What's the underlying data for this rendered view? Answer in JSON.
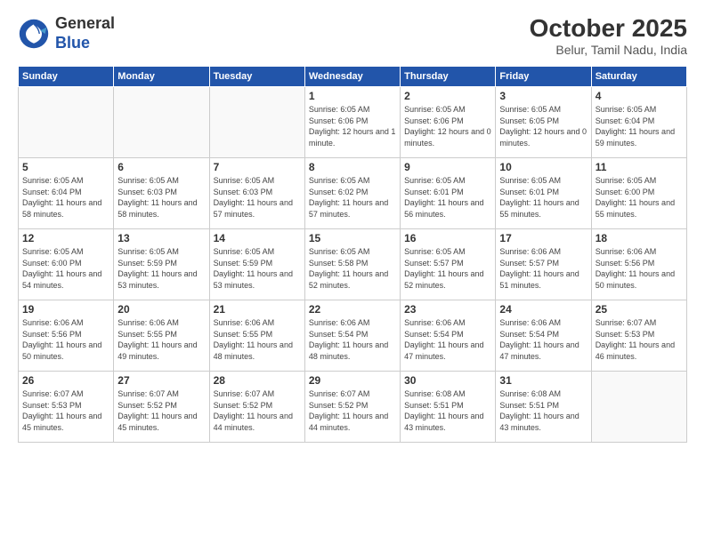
{
  "header": {
    "logo_general": "General",
    "logo_blue": "Blue",
    "month_year": "October 2025",
    "location": "Belur, Tamil Nadu, India"
  },
  "weekdays": [
    "Sunday",
    "Monday",
    "Tuesday",
    "Wednesday",
    "Thursday",
    "Friday",
    "Saturday"
  ],
  "weeks": [
    [
      {
        "day": "",
        "sunrise": "",
        "sunset": "",
        "daylight": ""
      },
      {
        "day": "",
        "sunrise": "",
        "sunset": "",
        "daylight": ""
      },
      {
        "day": "",
        "sunrise": "",
        "sunset": "",
        "daylight": ""
      },
      {
        "day": "1",
        "sunrise": "Sunrise: 6:05 AM",
        "sunset": "Sunset: 6:06 PM",
        "daylight": "Daylight: 12 hours and 1 minute."
      },
      {
        "day": "2",
        "sunrise": "Sunrise: 6:05 AM",
        "sunset": "Sunset: 6:06 PM",
        "daylight": "Daylight: 12 hours and 0 minutes."
      },
      {
        "day": "3",
        "sunrise": "Sunrise: 6:05 AM",
        "sunset": "Sunset: 6:05 PM",
        "daylight": "Daylight: 12 hours and 0 minutes."
      },
      {
        "day": "4",
        "sunrise": "Sunrise: 6:05 AM",
        "sunset": "Sunset: 6:04 PM",
        "daylight": "Daylight: 11 hours and 59 minutes."
      }
    ],
    [
      {
        "day": "5",
        "sunrise": "Sunrise: 6:05 AM",
        "sunset": "Sunset: 6:04 PM",
        "daylight": "Daylight: 11 hours and 58 minutes."
      },
      {
        "day": "6",
        "sunrise": "Sunrise: 6:05 AM",
        "sunset": "Sunset: 6:03 PM",
        "daylight": "Daylight: 11 hours and 58 minutes."
      },
      {
        "day": "7",
        "sunrise": "Sunrise: 6:05 AM",
        "sunset": "Sunset: 6:03 PM",
        "daylight": "Daylight: 11 hours and 57 minutes."
      },
      {
        "day": "8",
        "sunrise": "Sunrise: 6:05 AM",
        "sunset": "Sunset: 6:02 PM",
        "daylight": "Daylight: 11 hours and 57 minutes."
      },
      {
        "day": "9",
        "sunrise": "Sunrise: 6:05 AM",
        "sunset": "Sunset: 6:01 PM",
        "daylight": "Daylight: 11 hours and 56 minutes."
      },
      {
        "day": "10",
        "sunrise": "Sunrise: 6:05 AM",
        "sunset": "Sunset: 6:01 PM",
        "daylight": "Daylight: 11 hours and 55 minutes."
      },
      {
        "day": "11",
        "sunrise": "Sunrise: 6:05 AM",
        "sunset": "Sunset: 6:00 PM",
        "daylight": "Daylight: 11 hours and 55 minutes."
      }
    ],
    [
      {
        "day": "12",
        "sunrise": "Sunrise: 6:05 AM",
        "sunset": "Sunset: 6:00 PM",
        "daylight": "Daylight: 11 hours and 54 minutes."
      },
      {
        "day": "13",
        "sunrise": "Sunrise: 6:05 AM",
        "sunset": "Sunset: 5:59 PM",
        "daylight": "Daylight: 11 hours and 53 minutes."
      },
      {
        "day": "14",
        "sunrise": "Sunrise: 6:05 AM",
        "sunset": "Sunset: 5:59 PM",
        "daylight": "Daylight: 11 hours and 53 minutes."
      },
      {
        "day": "15",
        "sunrise": "Sunrise: 6:05 AM",
        "sunset": "Sunset: 5:58 PM",
        "daylight": "Daylight: 11 hours and 52 minutes."
      },
      {
        "day": "16",
        "sunrise": "Sunrise: 6:05 AM",
        "sunset": "Sunset: 5:57 PM",
        "daylight": "Daylight: 11 hours and 52 minutes."
      },
      {
        "day": "17",
        "sunrise": "Sunrise: 6:06 AM",
        "sunset": "Sunset: 5:57 PM",
        "daylight": "Daylight: 11 hours and 51 minutes."
      },
      {
        "day": "18",
        "sunrise": "Sunrise: 6:06 AM",
        "sunset": "Sunset: 5:56 PM",
        "daylight": "Daylight: 11 hours and 50 minutes."
      }
    ],
    [
      {
        "day": "19",
        "sunrise": "Sunrise: 6:06 AM",
        "sunset": "Sunset: 5:56 PM",
        "daylight": "Daylight: 11 hours and 50 minutes."
      },
      {
        "day": "20",
        "sunrise": "Sunrise: 6:06 AM",
        "sunset": "Sunset: 5:55 PM",
        "daylight": "Daylight: 11 hours and 49 minutes."
      },
      {
        "day": "21",
        "sunrise": "Sunrise: 6:06 AM",
        "sunset": "Sunset: 5:55 PM",
        "daylight": "Daylight: 11 hours and 48 minutes."
      },
      {
        "day": "22",
        "sunrise": "Sunrise: 6:06 AM",
        "sunset": "Sunset: 5:54 PM",
        "daylight": "Daylight: 11 hours and 48 minutes."
      },
      {
        "day": "23",
        "sunrise": "Sunrise: 6:06 AM",
        "sunset": "Sunset: 5:54 PM",
        "daylight": "Daylight: 11 hours and 47 minutes."
      },
      {
        "day": "24",
        "sunrise": "Sunrise: 6:06 AM",
        "sunset": "Sunset: 5:54 PM",
        "daylight": "Daylight: 11 hours and 47 minutes."
      },
      {
        "day": "25",
        "sunrise": "Sunrise: 6:07 AM",
        "sunset": "Sunset: 5:53 PM",
        "daylight": "Daylight: 11 hours and 46 minutes."
      }
    ],
    [
      {
        "day": "26",
        "sunrise": "Sunrise: 6:07 AM",
        "sunset": "Sunset: 5:53 PM",
        "daylight": "Daylight: 11 hours and 45 minutes."
      },
      {
        "day": "27",
        "sunrise": "Sunrise: 6:07 AM",
        "sunset": "Sunset: 5:52 PM",
        "daylight": "Daylight: 11 hours and 45 minutes."
      },
      {
        "day": "28",
        "sunrise": "Sunrise: 6:07 AM",
        "sunset": "Sunset: 5:52 PM",
        "daylight": "Daylight: 11 hours and 44 minutes."
      },
      {
        "day": "29",
        "sunrise": "Sunrise: 6:07 AM",
        "sunset": "Sunset: 5:52 PM",
        "daylight": "Daylight: 11 hours and 44 minutes."
      },
      {
        "day": "30",
        "sunrise": "Sunrise: 6:08 AM",
        "sunset": "Sunset: 5:51 PM",
        "daylight": "Daylight: 11 hours and 43 minutes."
      },
      {
        "day": "31",
        "sunrise": "Sunrise: 6:08 AM",
        "sunset": "Sunset: 5:51 PM",
        "daylight": "Daylight: 11 hours and 43 minutes."
      },
      {
        "day": "",
        "sunrise": "",
        "sunset": "",
        "daylight": ""
      }
    ]
  ]
}
